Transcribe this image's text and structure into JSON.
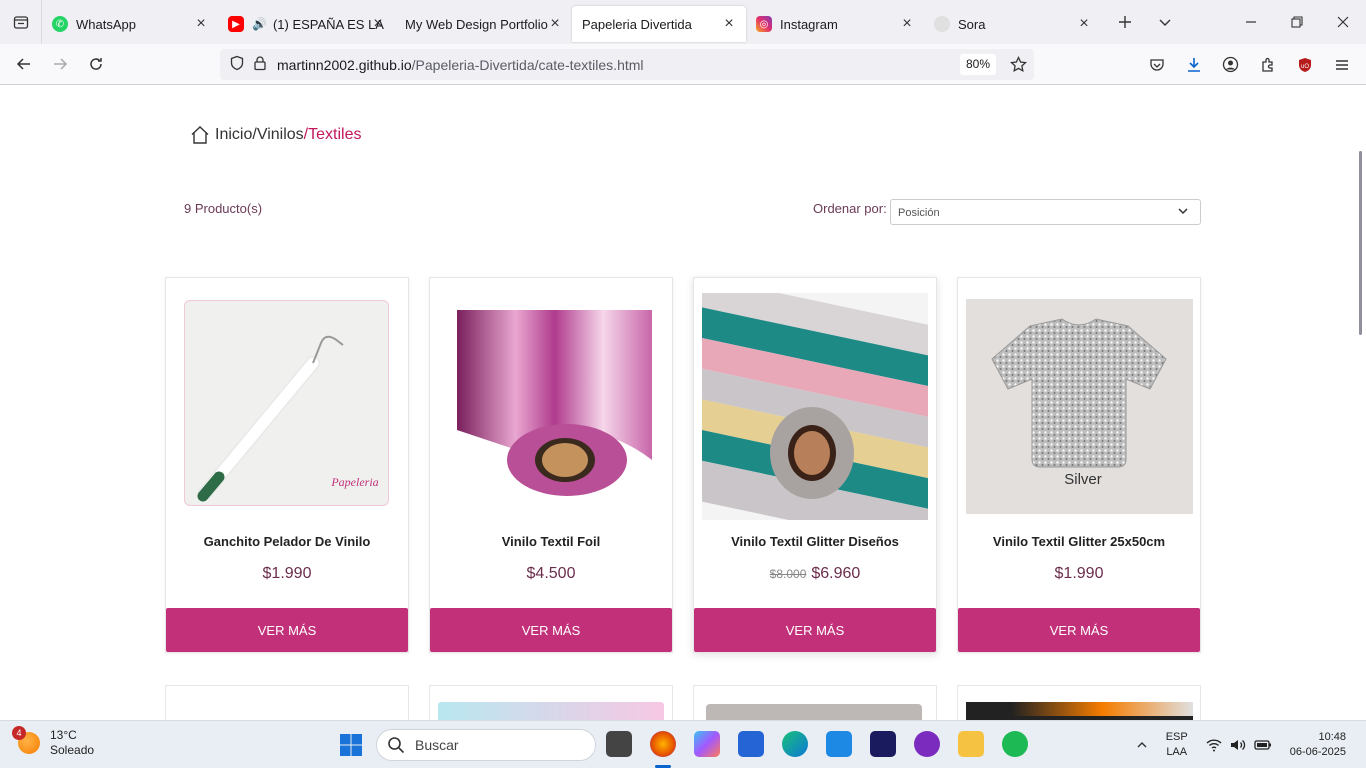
{
  "browser": {
    "tabs": [
      {
        "label": "WhatsApp",
        "icon": "whatsapp-icon",
        "color": "#25d366"
      },
      {
        "label": "(1) ESPAÑA ES LA",
        "icon": "youtube-icon",
        "color": "#ff0000"
      },
      {
        "label": "My Web Design Portfolio",
        "icon": "",
        "color": ""
      },
      {
        "label": "Papeleria Divertida",
        "icon": "",
        "color": ""
      },
      {
        "label": "Instagram",
        "icon": "instagram-icon",
        "color": "#e1306c"
      },
      {
        "label": "Sora",
        "icon": "sora-icon",
        "color": "#cccccc"
      }
    ],
    "url_host": "martinn2002.github.io",
    "url_path": "/Papeleria-Divertida/cate-textiles.html",
    "zoom": "80%"
  },
  "page": {
    "breadcrumb": {
      "home": "Inicio",
      "sep1": " /",
      "cat": "Vinilos",
      "sep2": " /",
      "current": "Textiles"
    },
    "count": "9 Producto(s)",
    "sort_label": "Ordenar por:",
    "sort_value": "Posición",
    "products": [
      {
        "name": "Ganchito Pelador De Vinilo",
        "price": "$1.990",
        "old_price": "",
        "button": "VER MÁS"
      },
      {
        "name": "Vinilo Textil Foil",
        "price": "$4.500",
        "old_price": "",
        "button": "VER MÁS"
      },
      {
        "name": "Vinilo Textil Glitter Diseños",
        "price": "$6.960",
        "old_price": "$8.000",
        "button": "VER MÁS"
      },
      {
        "name": "Vinilo Textil Glitter 25x50cm",
        "price": "$1.990",
        "old_price": "",
        "button": "VER MÁS",
        "image_label": "Silver"
      }
    ],
    "accent_color": "#c2307a"
  },
  "taskbar": {
    "temp": "13°C",
    "condition": "Soleado",
    "badge": "4",
    "search_placeholder": "Buscar",
    "lang1": "ESP",
    "lang2": "LAA",
    "time": "10:48",
    "date": "06-06-2025"
  }
}
